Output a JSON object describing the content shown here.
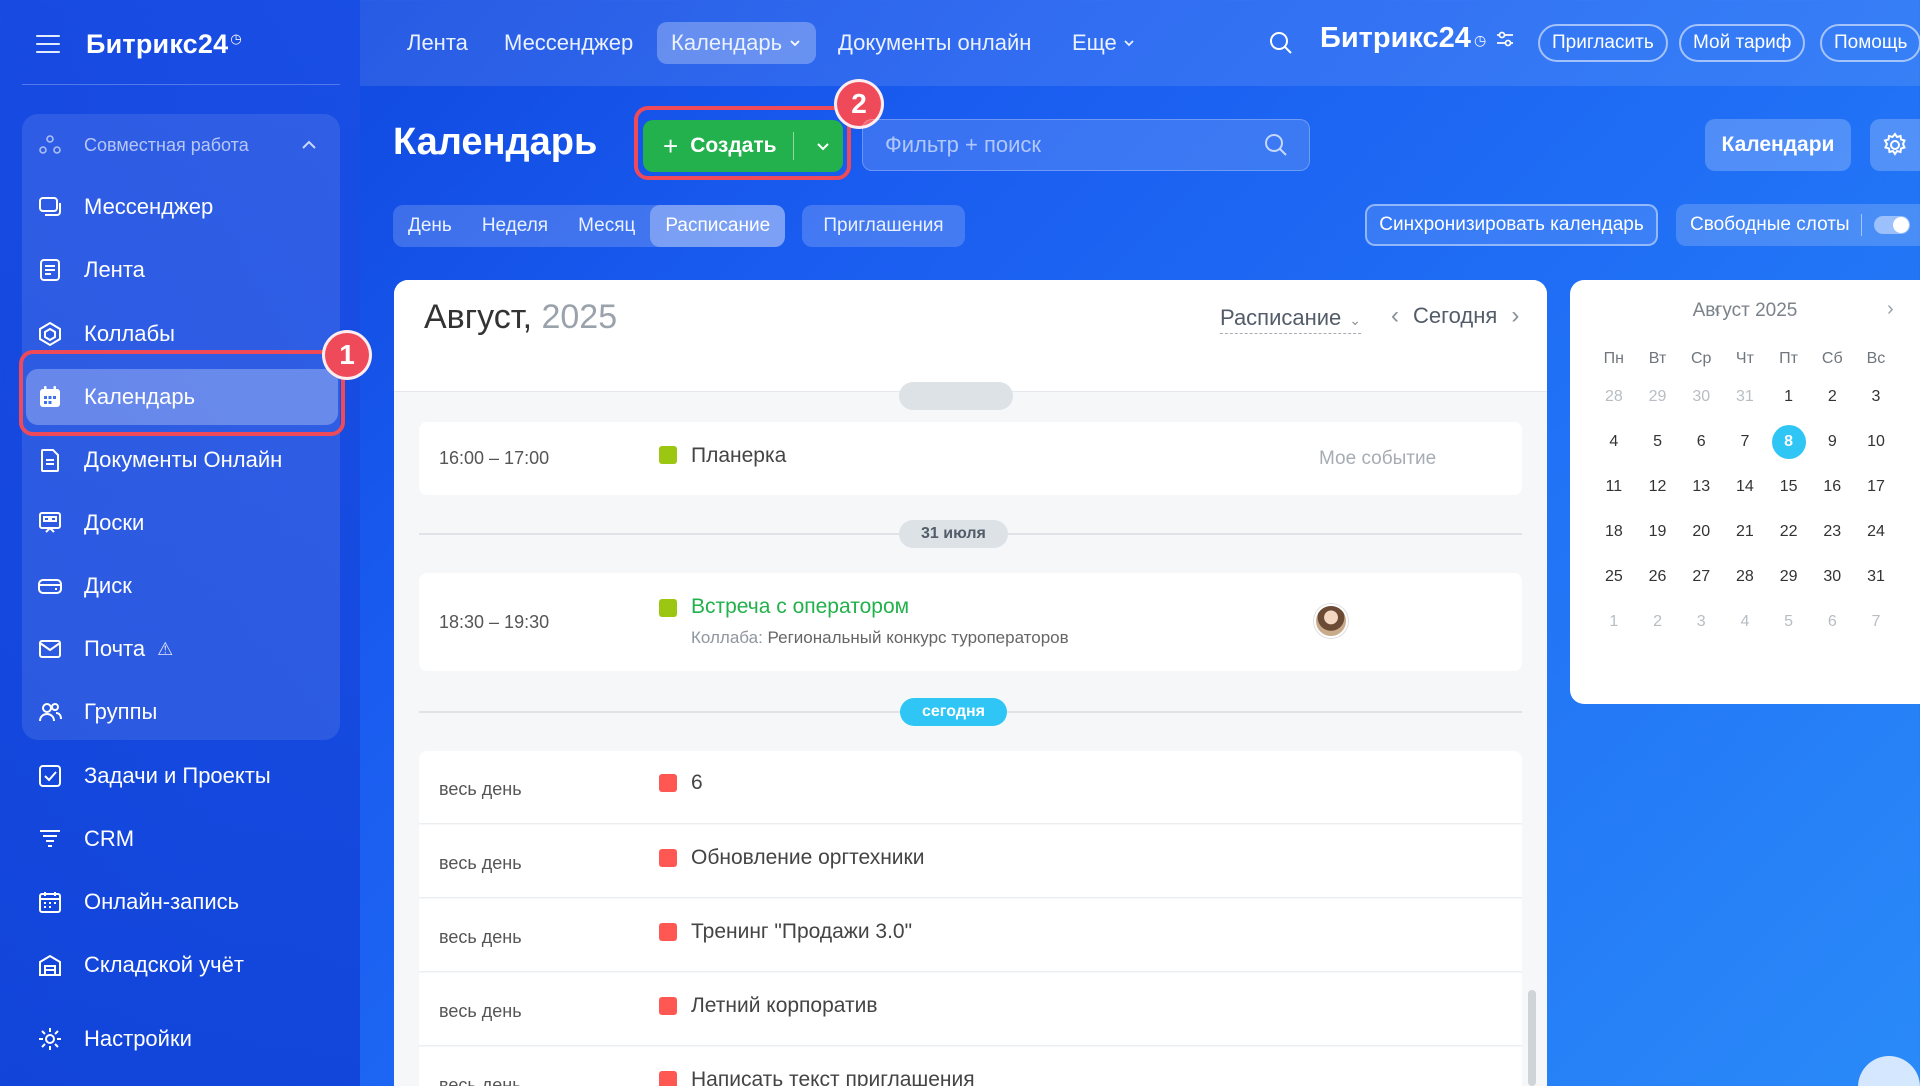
{
  "brand": {
    "name": "Битрикс24",
    "clock_glyph": "◷"
  },
  "sidebar": {
    "group_header": "Совместная работа",
    "items": [
      {
        "label": "Мессенджер",
        "icon": "messenger-icon"
      },
      {
        "label": "Лента",
        "icon": "feed-icon"
      },
      {
        "label": "Коллабы",
        "icon": "collabs-icon"
      },
      {
        "label": "Календарь",
        "icon": "calendar-icon",
        "active": true
      },
      {
        "label": "Документы Онлайн",
        "icon": "documents-icon"
      },
      {
        "label": "Доски",
        "icon": "boards-icon"
      },
      {
        "label": "Диск",
        "icon": "disk-icon"
      },
      {
        "label": "Почта",
        "icon": "mail-icon",
        "warning": "⚠"
      },
      {
        "label": "Группы",
        "icon": "groups-icon"
      }
    ],
    "extra_items": [
      {
        "label": "Задачи и Проекты",
        "icon": "tasks-icon"
      },
      {
        "label": "CRM",
        "icon": "crm-icon"
      },
      {
        "label": "Онлайн-запись",
        "icon": "booking-icon"
      },
      {
        "label": "Складской учёт",
        "icon": "warehouse-icon"
      },
      {
        "label": "Настройки",
        "icon": "settings-icon"
      }
    ]
  },
  "callouts": {
    "one": "1",
    "two": "2",
    "color": "#ef4a5a"
  },
  "topnav": {
    "items": [
      "Лента",
      "Мессенджер",
      "Календарь",
      "Документы онлайн",
      "Еще"
    ],
    "brand": "Битрикс24",
    "invite": "Пригласить",
    "tariff": "Мой тариф",
    "help": "Помощь"
  },
  "page": {
    "title": "Календарь",
    "create_label": "Создать",
    "search_placeholder": "Фильтр + поиск",
    "calendars_label": "Календари",
    "views": [
      "День",
      "Неделя",
      "Месяц",
      "Расписание"
    ],
    "active_view": "Расписание",
    "invites_label": "Приглашения",
    "sync_label": "Синхронизировать календарь",
    "free_slots_label": "Свободные слоты"
  },
  "schedule": {
    "month": "Август,",
    "year": "2025",
    "view_select": "Расписание",
    "today_label": "Сегодня",
    "events_before": [
      {
        "time": "16:00 – 17:00",
        "name": "Планерка",
        "color": "#9bc612",
        "meta": "Мое событие"
      }
    ],
    "date_chip_1": "31 июля",
    "event_collab": {
      "time": "18:30 – 19:30",
      "name": "Встреча с оператором",
      "color": "#9bc612",
      "name_color": "#22b14c",
      "sub_prefix": "Коллаба:",
      "sub_value": "Региональный конкурс туроператоров"
    },
    "date_chip_today": "сегодня",
    "all_day_label": "весь день",
    "events_today": [
      {
        "name": "6",
        "color": "#ff5752"
      },
      {
        "name": "Обновление оргтехники",
        "color": "#ff5752"
      },
      {
        "name": "Тренинг \"Продажи 3.0\"",
        "color": "#ff5752"
      },
      {
        "name": "Летний корпоратив",
        "color": "#ff5752"
      },
      {
        "name": "Написать текст приглашения",
        "color": "#ff5752"
      }
    ]
  },
  "mini_calendar": {
    "title": "Август 2025",
    "weekdays": [
      "Пн",
      "Вт",
      "Ср",
      "Чт",
      "Пт",
      "Сб",
      "Вс"
    ],
    "weeks": [
      [
        "28",
        "29",
        "30",
        "31",
        "1",
        "2",
        "3"
      ],
      [
        "4",
        "5",
        "6",
        "7",
        "8",
        "9",
        "10"
      ],
      [
        "11",
        "12",
        "13",
        "14",
        "15",
        "16",
        "17"
      ],
      [
        "18",
        "19",
        "20",
        "21",
        "22",
        "23",
        "24"
      ],
      [
        "25",
        "26",
        "27",
        "28",
        "29",
        "30",
        "31"
      ],
      [
        "1",
        "2",
        "3",
        "4",
        "5",
        "6",
        "7"
      ]
    ],
    "selected": "8",
    "accent": "#2fc6f6"
  }
}
